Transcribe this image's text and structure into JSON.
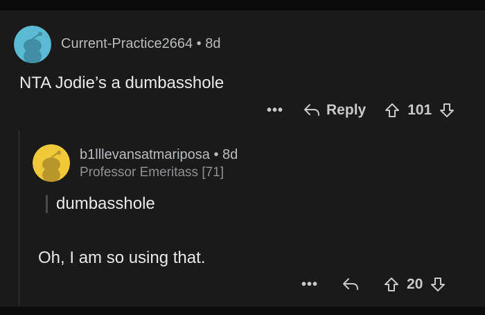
{
  "comment1": {
    "username": "Current-Practice2664",
    "separator": "•",
    "age": "8d",
    "body": "NTA Jodie’s a dumbasshole",
    "actions": {
      "more": "•••",
      "reply": "Reply",
      "score": "101"
    },
    "avatar_color": "#5bbbd3"
  },
  "comment2": {
    "username": "b1lllevansatmariposa",
    "separator": "•",
    "age": "8d",
    "flair": "Professor Emeritass [71]",
    "quote": "dumbasshole",
    "body": "Oh, I am so using that.",
    "actions": {
      "more": "•••",
      "score": "20"
    },
    "avatar_color": "#f0c93a"
  },
  "colors": {
    "background": "#1a1a1b",
    "text": "#e7e9ea",
    "meta": "#b9bcbe"
  }
}
